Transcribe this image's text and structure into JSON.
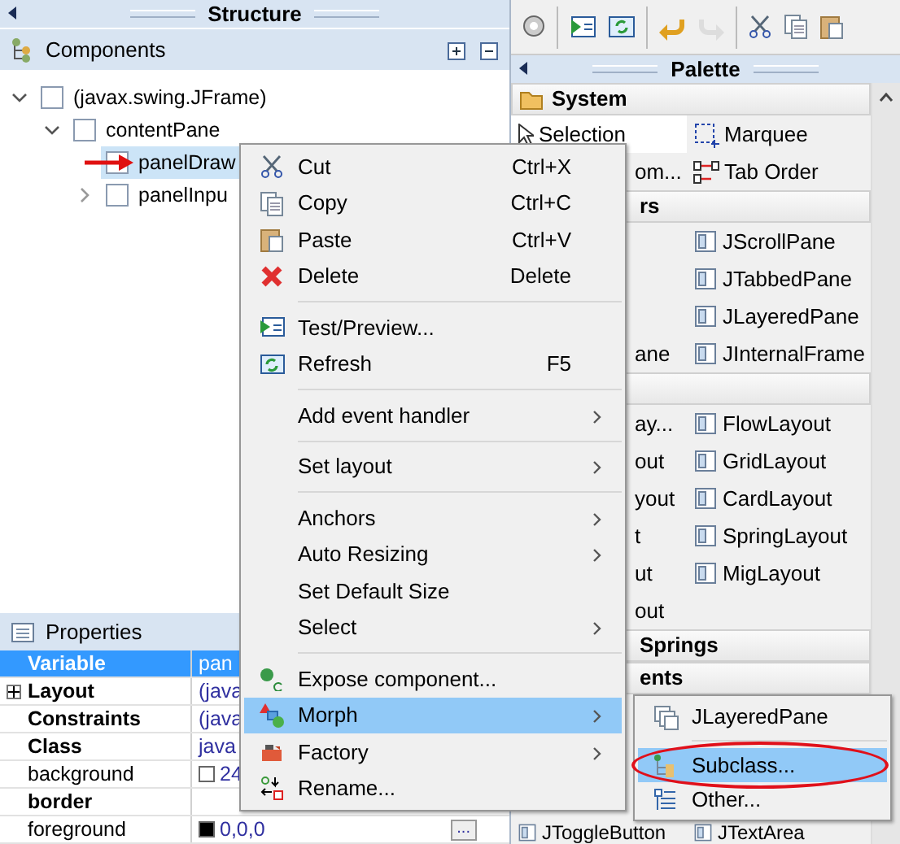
{
  "structure": {
    "title": "Structure",
    "components_title": "Components",
    "tree": [
      {
        "label": "(javax.swing.JFrame)",
        "expanded": true,
        "selected": false,
        "children": [
          {
            "label": "contentPane",
            "expanded": true,
            "selected": false,
            "children": [
              {
                "label": "panelDraw",
                "selected": true,
                "pointed_at": true
              },
              {
                "label": "panelInpu",
                "expanded": false,
                "selected": false
              }
            ]
          }
        ]
      }
    ]
  },
  "properties": {
    "title": "Properties",
    "rows": [
      {
        "name": "Variable",
        "value": "pan",
        "bold": true,
        "selected": true
      },
      {
        "name": "Layout",
        "value": "(java",
        "bold": true,
        "selected": false,
        "expanded": false
      },
      {
        "name": "Constraints",
        "value": "(java",
        "bold": true,
        "selected": false
      },
      {
        "name": "Class",
        "value": "java",
        "bold": true,
        "selected": false
      },
      {
        "name": "background",
        "value": "24",
        "bold": false,
        "selected": false,
        "color": "#ffffff"
      },
      {
        "name": "border",
        "bold": true,
        "selected": false
      },
      {
        "name": "foreground",
        "value": "0,0,0",
        "bold": false,
        "selected": false,
        "color": "#000000",
        "button": "..."
      }
    ]
  },
  "toolbar": [
    {
      "disabled": false
    },
    {
      "disabled": false
    },
    {
      "disabled": false
    },
    {
      "disabled": false
    },
    {
      "disabled": true
    },
    {
      "disabled": false
    },
    {
      "disabled": false
    },
    {
      "disabled": false
    }
  ],
  "palette": {
    "title": "Palette",
    "sections": [
      {
        "title": "System",
        "rows": [
          {
            "left": {
              "label": "Selection",
              "selected": true
            },
            "right": {
              "label": "Marquee",
              "selected": false
            }
          },
          {
            "left": {
              "label": "om...",
              "selected": false,
              "partly_hidden": true
            },
            "right": {
              "label": "Tab Order",
              "selected": false
            }
          }
        ]
      },
      {
        "title": "rs",
        "partly_hidden": true,
        "rows": [
          {
            "right": {
              "label": "JScrollPane",
              "selected": false
            }
          },
          {
            "right": {
              "label": "JTabbedPane",
              "selected": false
            }
          },
          {
            "right": {
              "label": "JLayeredPane",
              "selected": false
            }
          },
          {
            "left": {
              "label": "ane",
              "selected": false,
              "partly_hidden": true
            },
            "right": {
              "label": "JInternalFrame",
              "selected": false
            }
          }
        ]
      },
      {
        "rows": [
          {
            "left": {
              "label": "ay...",
              "selected": false,
              "partly_hidden": true
            },
            "right": {
              "label": "FlowLayout",
              "selected": false
            }
          },
          {
            "left": {
              "label": "out",
              "selected": false,
              "partly_hidden": true
            },
            "right": {
              "label": "GridLayout",
              "selected": false
            }
          },
          {
            "left": {
              "label": "yout",
              "selected": false,
              "partly_hidden": true
            },
            "right": {
              "label": "CardLayout",
              "selected": false
            }
          },
          {
            "left": {
              "label": "t",
              "selected": false,
              "partly_hidden": true
            },
            "right": {
              "label": "SpringLayout",
              "selected": false
            }
          },
          {
            "left": {
              "label": "ut",
              "selected": false,
              "partly_hidden": true
            },
            "right": {
              "label": "MigLayout",
              "selected": false
            }
          },
          {
            "left": {
              "label": "out",
              "selected": false,
              "partly_hidden": true
            }
          }
        ]
      },
      {
        "title": "Springs",
        "partly_hidden": true
      },
      {
        "title": "ents",
        "partly_hidden": true,
        "rows": [
          {
            "left": {
              "label": "JToggleButton",
              "selected": false
            },
            "right": {
              "label": "JTextArea",
              "selected": false
            }
          }
        ]
      }
    ]
  },
  "context_menu": {
    "items": [
      {
        "kind": "item",
        "label": "Cut",
        "shortcut": "Ctrl+X",
        "submenu": false,
        "selected": false
      },
      {
        "kind": "item",
        "label": "Copy",
        "shortcut": "Ctrl+C",
        "submenu": false,
        "selected": false
      },
      {
        "kind": "item",
        "label": "Paste",
        "shortcut": "Ctrl+V",
        "submenu": false,
        "selected": false
      },
      {
        "kind": "item",
        "label": "Delete",
        "shortcut": "Delete",
        "submenu": false,
        "selected": false
      },
      {
        "kind": "separator"
      },
      {
        "kind": "item",
        "label": "Test/Preview...",
        "submenu": false,
        "selected": false
      },
      {
        "kind": "item",
        "label": "Refresh",
        "shortcut": "F5",
        "submenu": false,
        "selected": false
      },
      {
        "kind": "separator"
      },
      {
        "kind": "item",
        "label": "Add event handler",
        "submenu": true,
        "selected": false
      },
      {
        "kind": "separator"
      },
      {
        "kind": "item",
        "label": "Set layout",
        "submenu": true,
        "selected": false
      },
      {
        "kind": "separator"
      },
      {
        "kind": "item",
        "label": "Anchors",
        "submenu": true,
        "selected": false
      },
      {
        "kind": "item",
        "label": "Auto Resizing",
        "submenu": true,
        "selected": false
      },
      {
        "kind": "item",
        "label": "Set Default Size",
        "submenu": false,
        "selected": false
      },
      {
        "kind": "item",
        "label": "Select",
        "submenu": true,
        "selected": false
      },
      {
        "kind": "separator"
      },
      {
        "kind": "item",
        "label": "Expose component...",
        "submenu": false,
        "selected": false
      },
      {
        "kind": "item",
        "label": "Morph",
        "submenu": true,
        "selected": true
      },
      {
        "kind": "item",
        "label": "Factory",
        "submenu": true,
        "selected": false
      },
      {
        "kind": "item",
        "label": "Rename...",
        "submenu": false,
        "selected": false
      }
    ]
  },
  "submenu": {
    "items": [
      {
        "kind": "item",
        "label": "JLayeredPane",
        "selected": false,
        "circled": false
      },
      {
        "kind": "separator"
      },
      {
        "kind": "item",
        "label": "Subclass...",
        "selected": true,
        "circled": true
      },
      {
        "kind": "item",
        "label": "Other...",
        "selected": false,
        "circled": false
      }
    ]
  }
}
